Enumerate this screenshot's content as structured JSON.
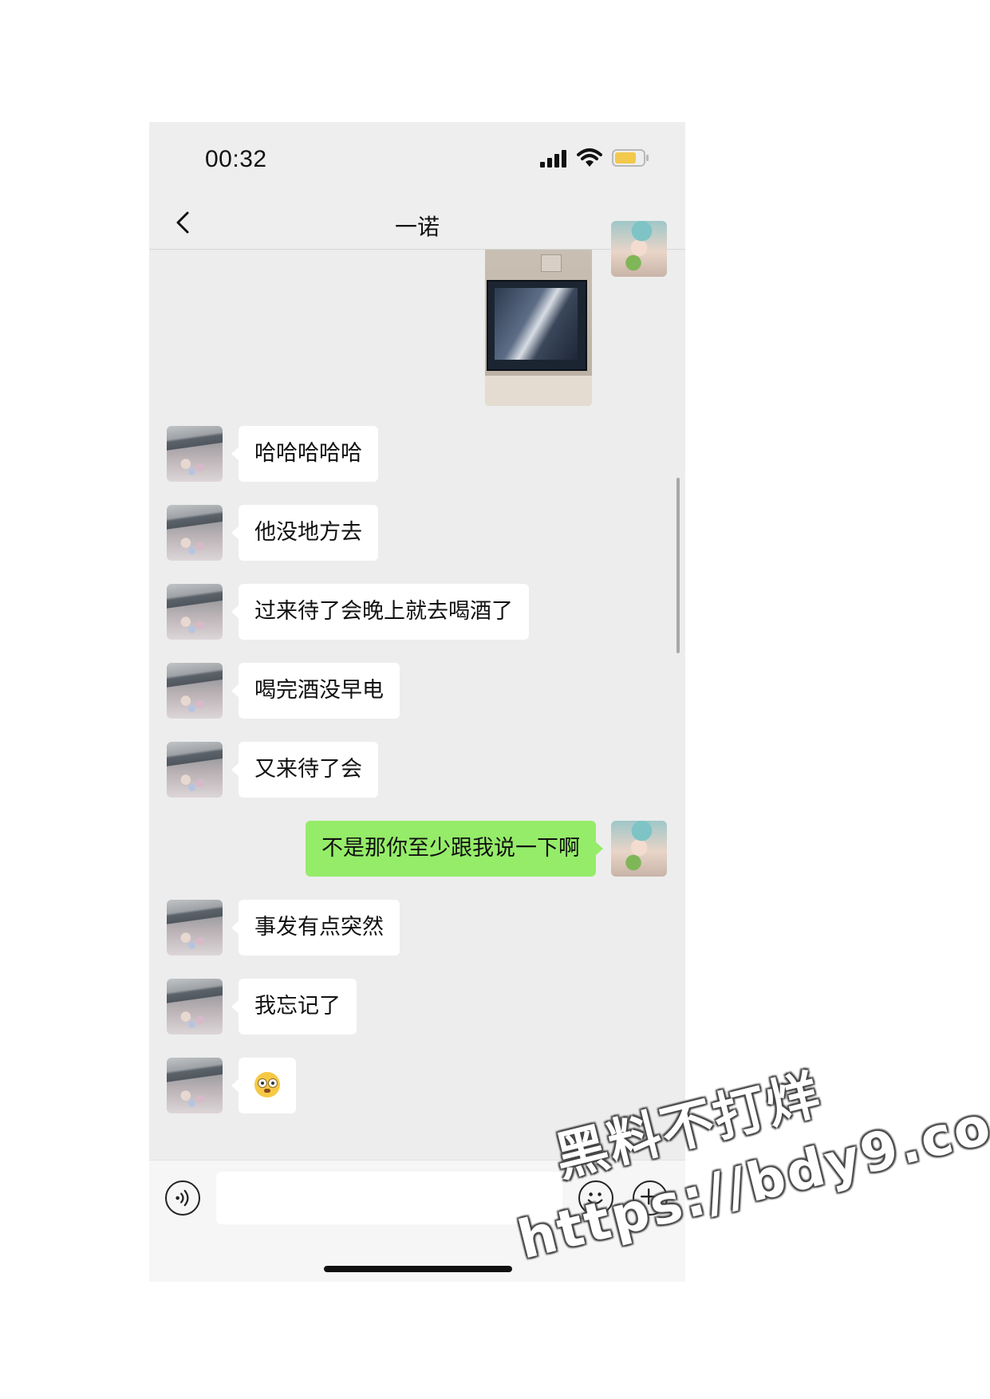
{
  "status_bar": {
    "time": "00:32",
    "signal_icon": "cellular-signal-icon",
    "wifi_icon": "wifi-icon",
    "battery_icon": "battery-icon",
    "battery_color": "#f2c94c"
  },
  "nav": {
    "title": "一诺",
    "back_icon": "chevron-left-icon",
    "more_icon": "more-dots-icon"
  },
  "colors": {
    "self_bubble": "#95ec69",
    "friend_bubble": "#ffffff",
    "chat_bg": "#ededed"
  },
  "messages": [
    {
      "sender": "self",
      "type": "image"
    },
    {
      "sender": "friend",
      "type": "text",
      "text": "哈哈哈哈哈"
    },
    {
      "sender": "friend",
      "type": "text",
      "text": "他没地方去"
    },
    {
      "sender": "friend",
      "type": "text",
      "text": "过来待了会晚上就去喝酒了"
    },
    {
      "sender": "friend",
      "type": "text",
      "text": "喝完酒没早电"
    },
    {
      "sender": "friend",
      "type": "text",
      "text": "又来待了会"
    },
    {
      "sender": "self",
      "type": "text",
      "text": "不是那你至少跟我说一下啊"
    },
    {
      "sender": "friend",
      "type": "text",
      "text": "事发有点突然"
    },
    {
      "sender": "friend",
      "type": "text",
      "text": "我忘记了"
    },
    {
      "sender": "friend",
      "type": "emoji",
      "emoji": "flushed-face-icon"
    }
  ],
  "input_bar": {
    "voice_icon": "voice-icon",
    "emoji_icon": "smiley-icon",
    "plus_icon": "plus-icon",
    "input_value": ""
  },
  "watermark": {
    "line1": "黑料不打烊",
    "line2": "https://bdy9.co"
  }
}
